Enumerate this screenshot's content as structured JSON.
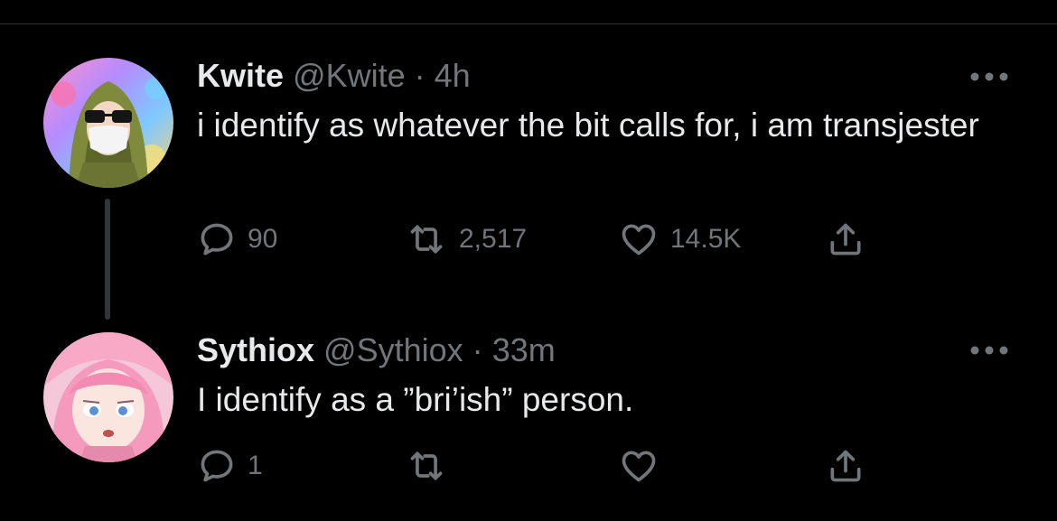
{
  "tweets": [
    {
      "display_name": "Kwite",
      "handle": "@Kwite",
      "separator": "·",
      "time": "4h",
      "text": "i identify as whatever the bit calls for, i am transjester",
      "replies": "90",
      "retweets": "2,517",
      "likes": "14.5K"
    },
    {
      "display_name": "Sythiox",
      "handle": "@Sythiox",
      "separator": "·",
      "time": "33m",
      "text": "I identify as a ”bri’ish” person.",
      "replies": "1",
      "retweets": "",
      "likes": ""
    }
  ],
  "icons": {
    "reply": "reply-icon",
    "retweet": "retweet-icon",
    "like": "heart-icon",
    "share": "share-icon",
    "more": "more-options-icon"
  },
  "colors": {
    "background": "#000000",
    "primary_text": "#e7e9ea",
    "secondary_text": "#71767b",
    "divider": "#2f3336",
    "thread_line": "#333639"
  }
}
